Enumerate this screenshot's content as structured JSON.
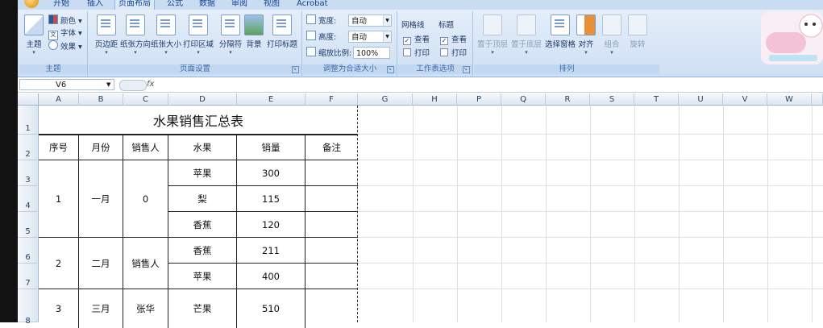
{
  "menu_tabs": [
    "开始",
    "插入",
    "页面布局",
    "公式",
    "数据",
    "审阅",
    "视图",
    "Acrobat"
  ],
  "active_tab": "页面布局",
  "ribbon": {
    "theme": {
      "main": "主题",
      "colors": "颜色",
      "fonts": "字体",
      "effects": "效果",
      "label": "主题"
    },
    "page_setup": {
      "buttons": [
        "页边距",
        "纸张方向",
        "纸张大小",
        "打印区域",
        "分隔符",
        "背景",
        "打印标题"
      ],
      "label": "页面设置"
    },
    "scale_to_fit": {
      "width_label": "宽度:",
      "width_value": "自动",
      "height_label": "高度:",
      "height_value": "自动",
      "scale_label": "缩放比例:",
      "scale_value": "100%",
      "label": "调整为合适大小"
    },
    "sheet_options": {
      "gridlines": "网格线",
      "headings": "标题",
      "view": "查看",
      "print": "打印",
      "label": "工作表选项"
    },
    "arrange": {
      "buttons": [
        "置于顶层",
        "置于底层",
        "选择窗格",
        "对齐",
        "组合",
        "旋转"
      ],
      "label": "排列"
    }
  },
  "name_box": "V6",
  "fx": "fx",
  "columns": [
    "A",
    "B",
    "C",
    "D",
    "E",
    "F",
    "G",
    "H",
    "P",
    "Q",
    "R",
    "S",
    "T",
    "U",
    "V",
    "W"
  ],
  "rows": [
    "1",
    "2",
    "3",
    "4",
    "5",
    "6",
    "7",
    "8"
  ],
  "table": {
    "title": "水果销售汇总表",
    "headers": [
      "序号",
      "月份",
      "销售人",
      "水果",
      "销量",
      "备注"
    ],
    "groups": [
      {
        "seq": "1",
        "month": "一月",
        "seller": "0"
      },
      {
        "seq": "2",
        "month": "二月",
        "seller": "销售人"
      },
      {
        "seq": "3",
        "month": "三月",
        "seller": "张华"
      }
    ],
    "items": [
      {
        "fruit": "苹果",
        "qty": "300"
      },
      {
        "fruit": "梨",
        "qty": "115"
      },
      {
        "fruit": "香蕉",
        "qty": "120"
      },
      {
        "fruit": "香蕉",
        "qty": "211"
      },
      {
        "fruit": "苹果",
        "qty": "400"
      },
      {
        "fruit": "芒果",
        "qty": "510"
      }
    ]
  }
}
